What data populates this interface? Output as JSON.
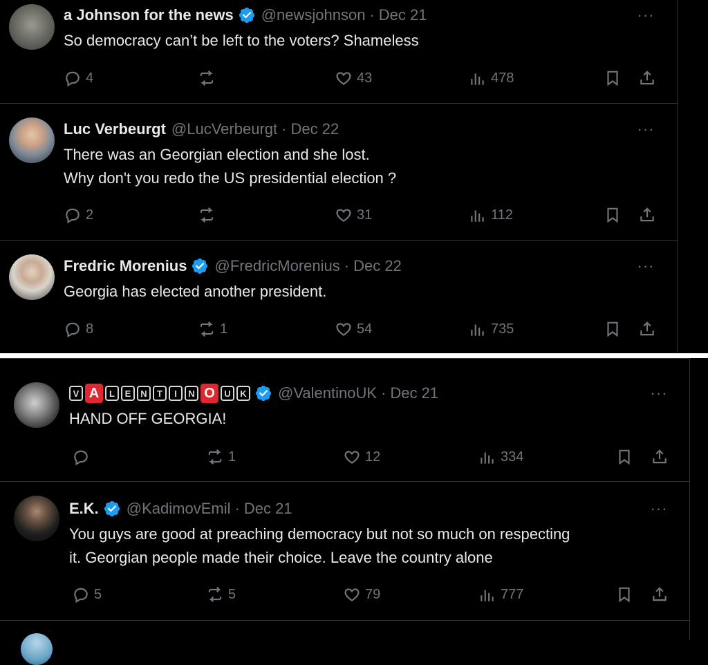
{
  "tweets": [
    {
      "name": "a Johnson for the news",
      "verified": true,
      "handle": "@newsjohnson",
      "dot": "·",
      "date": "Dec 21",
      "text": "So democracy can’t be left to the voters? Shameless",
      "replies": "4",
      "reposts": "",
      "likes": "43",
      "views": "478"
    },
    {
      "name": "Luc Verbeurgt",
      "verified": false,
      "handle": "@LucVerbeurgt",
      "dot": "·",
      "date": "Dec 22",
      "text": "There was an Georgian election and she lost.\nWhy don't you redo the US presidential election ?",
      "replies": "2",
      "reposts": "",
      "likes": "31",
      "views": "112"
    },
    {
      "name": "Fredric Morenius",
      "verified": true,
      "handle": "@FredricMorenius",
      "dot": "·",
      "date": "Dec 22",
      "text": "Georgia has elected another president.",
      "replies": "8",
      "reposts": "1",
      "likes": "54",
      "views": "735"
    },
    {
      "name_letters": [
        "V",
        "A",
        "L",
        "E",
        "N",
        "T",
        "I",
        "N",
        "O",
        "U",
        "K"
      ],
      "verified": true,
      "handle": "@ValentinoUK",
      "dot": "·",
      "date": "Dec 21",
      "text": "HAND OFF GEORGIA!",
      "replies": "",
      "reposts": "1",
      "likes": "12",
      "views": "334"
    },
    {
      "name": "E.K.",
      "verified": true,
      "handle": "@KadimovEmil",
      "dot": "·",
      "date": "Dec 21",
      "text": "You guys are good at preaching democracy but not so much on respecting\nit. Georgian people made their choice. Leave the country alone",
      "replies": "5",
      "reposts": "5",
      "likes": "79",
      "views": "777"
    }
  ],
  "more_label": "···",
  "colors": {
    "background": "#000000",
    "text": "#e7e9ea",
    "muted": "#71767b",
    "verified": "#1d9bf0",
    "divider": "#2f3336"
  },
  "icons": [
    "reply-icon",
    "repost-icon",
    "like-icon",
    "views-icon",
    "bookmark-icon",
    "share-icon",
    "verified-badge-icon",
    "more-icon"
  ]
}
